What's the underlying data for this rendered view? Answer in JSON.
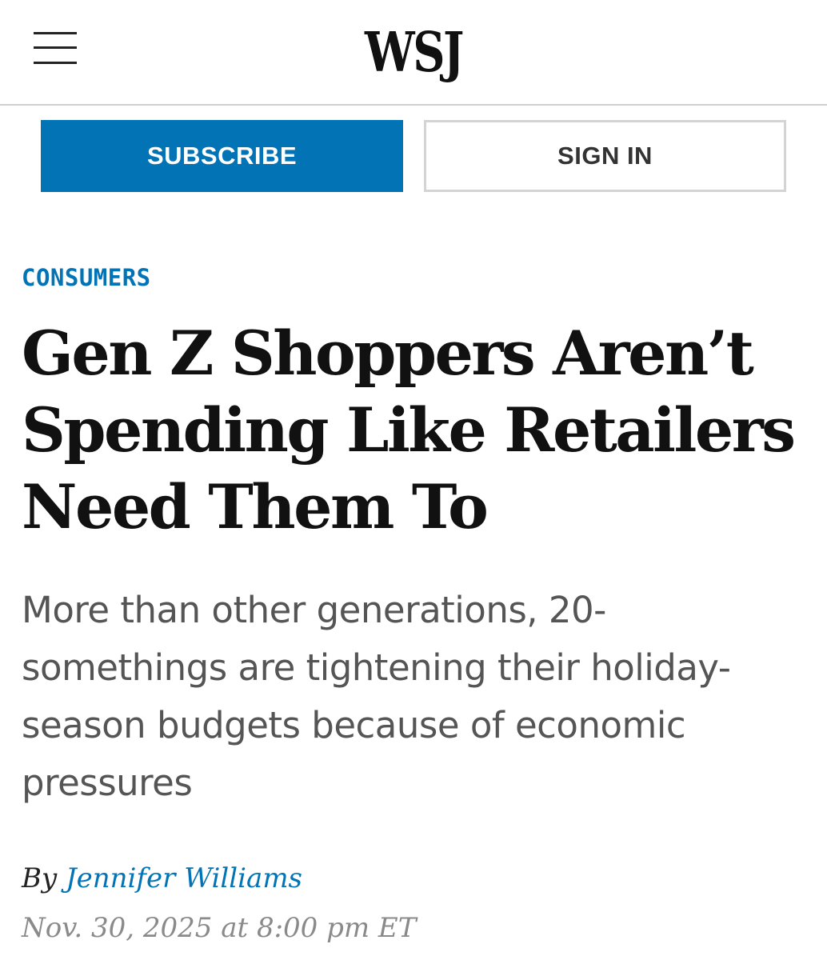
{
  "header": {
    "logo_text": "WSJ",
    "menu_icon": "hamburger-menu-icon"
  },
  "auth": {
    "subscribe_label": "SUBSCRIBE",
    "signin_label": "SIGN IN"
  },
  "article": {
    "section": "CONSUMERS",
    "headline": "Gen Z Shoppers Aren’t Spending Like Retailers Need Them To",
    "dek": "More than other generations, 20-somethings are tightening their holiday-season budgets because of economic pressures",
    "byline_prefix": "By",
    "author": "Jennifer Williams",
    "date": "Nov. 30, 2025 at 8:00 pm ET"
  },
  "colors": {
    "accent": "#0274b6",
    "headline": "#111111",
    "dek": "#555555",
    "date": "#8a8a8a",
    "divider": "#cfcfcf"
  }
}
